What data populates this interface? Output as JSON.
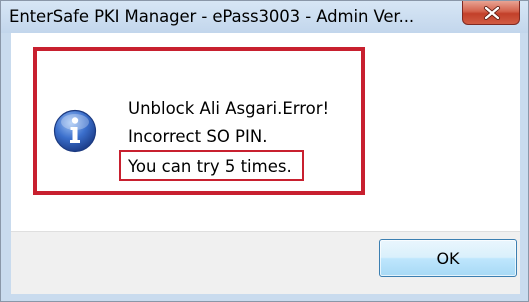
{
  "window": {
    "title": "EnterSafe PKI Manager - ePass3003 - Admin Ver...",
    "close_icon": "close-icon"
  },
  "message": {
    "icon": "info-icon",
    "line1": "Unblock Ali Asgari.Error!",
    "line2": "Incorrect SO PIN.",
    "line3": "You can try 5 times."
  },
  "buttons": {
    "ok_label": "OK"
  },
  "colors": {
    "highlight": "#c8202f",
    "title_bar": "#c9dbee",
    "close_button": "#c2402a"
  }
}
